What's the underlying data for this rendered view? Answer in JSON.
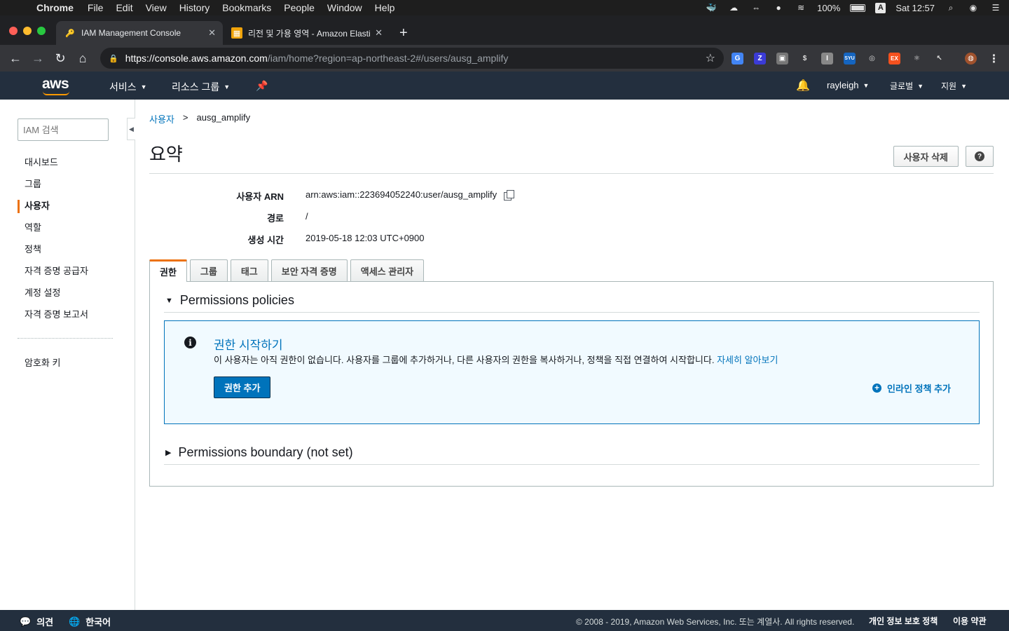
{
  "macos": {
    "app": "Chrome",
    "menus": [
      "File",
      "Edit",
      "View",
      "History",
      "Bookmarks",
      "People",
      "Window",
      "Help"
    ],
    "battery": "100%",
    "input_source": "A",
    "clock": "Sat 12:57"
  },
  "browser": {
    "tabs": [
      {
        "title": "IAM Management Console",
        "active": true
      },
      {
        "title": "리전 및 가용 영역 - Amazon Elasti",
        "active": false
      }
    ],
    "url_host": "https://console.aws.amazon.com",
    "url_path": "/iam/home?region=ap-northeast-2#/users/ausg_amplify"
  },
  "aws_nav": {
    "logo": "aws",
    "services": "서비스",
    "resource_groups": "리소스 그룹",
    "user": "rayleigh",
    "region": "글로벌",
    "support": "지원"
  },
  "sidebar": {
    "search_placeholder": "IAM 검색",
    "items": [
      {
        "label": "대시보드",
        "active": false
      },
      {
        "label": "그룹",
        "active": false
      },
      {
        "label": "사용자",
        "active": true
      },
      {
        "label": "역할",
        "active": false
      },
      {
        "label": "정책",
        "active": false
      },
      {
        "label": "자격 증명 공급자",
        "active": false
      },
      {
        "label": "계정 설정",
        "active": false
      },
      {
        "label": "자격 증명 보고서",
        "active": false
      }
    ],
    "bottom_item": "암호화 키"
  },
  "main": {
    "breadcrumb": {
      "parent": "사용자",
      "sep": ">",
      "current": "ausg_amplify"
    },
    "title": "요약",
    "delete_button": "사용자 삭제",
    "summary": {
      "arn_label": "사용자 ARN",
      "arn_value": "arn:aws:iam::223694052240:user/ausg_amplify",
      "path_label": "경로",
      "path_value": "/",
      "created_label": "생성 시간",
      "created_value": "2019-05-18 12:03 UTC+0900"
    },
    "tabs": [
      "권한",
      "그룹",
      "태그",
      "보안 자격 증명",
      "액세스 관리자"
    ],
    "permissions_policies": "Permissions policies",
    "info": {
      "heading": "권한 시작하기",
      "body": "이 사용자는 아직 권한이 없습니다. 사용자를 그룹에 추가하거나, 다른 사용자의 권한을 복사하거나, 정책을 직접 연결하여 시작합니다. ",
      "learn_more": "자세히 알아보기",
      "add_button": "권한 추가",
      "inline_policy": "인라인 정책 추가"
    },
    "permissions_boundary": "Permissions boundary (not set)"
  },
  "footer": {
    "feedback": "의견",
    "language": "한국어",
    "copyright": "© 2008 - 2019, Amazon Web Services, Inc. 또는 계열사. All rights reserved.",
    "privacy": "개인 정보 보호 정책",
    "terms": "이용 약관"
  },
  "colors": {
    "accent": "#ec7211",
    "link": "#0073bb",
    "nav_bg": "#232f3e"
  }
}
